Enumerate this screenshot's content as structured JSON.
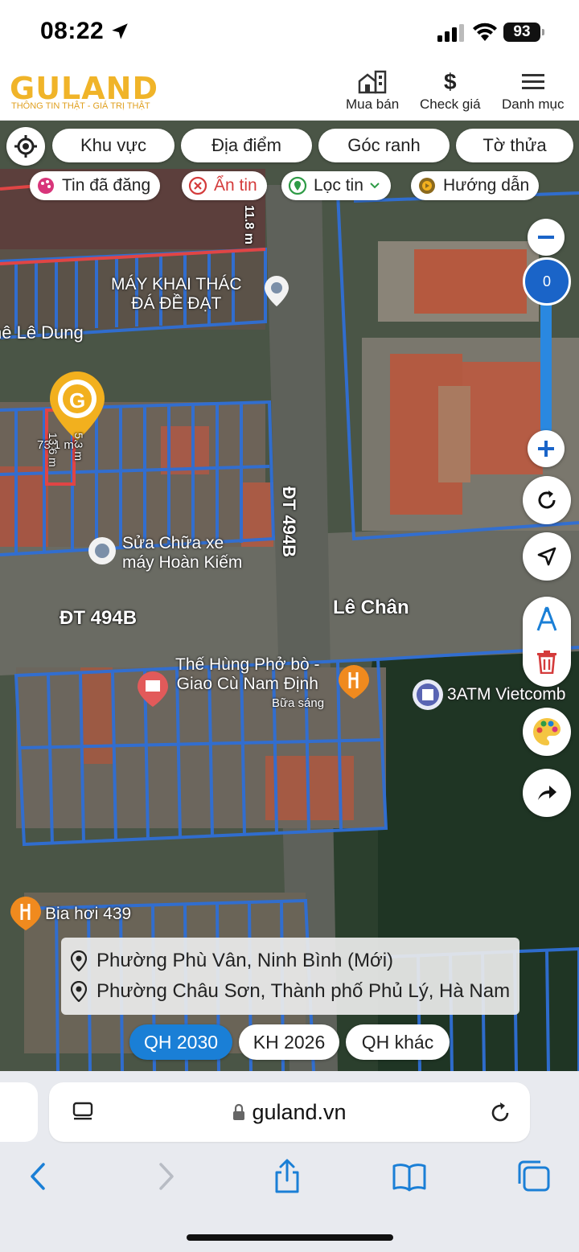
{
  "status_bar": {
    "time": "08:22",
    "battery": "93"
  },
  "header": {
    "logo_text": "GULAND",
    "logo_tagline": "THÔNG TIN THẬT - GIÁ TRỊ THẬT",
    "nav": [
      {
        "label": "Mua bán",
        "icon": "building-icon"
      },
      {
        "label": "Check giá",
        "icon": "dollar-icon"
      },
      {
        "label": "Danh mục",
        "icon": "menu-icon"
      }
    ]
  },
  "filters": {
    "buttons": [
      "Khu vực",
      "Địa điểm",
      "Góc ranh",
      "Tờ thửa"
    ],
    "chips": [
      {
        "label": "Tin đã đăng",
        "icon": "palette-icon"
      },
      {
        "label": "Ẩn tin",
        "icon": "close-circle-icon"
      },
      {
        "label": "Lọc tin",
        "icon": "location-filter-icon"
      },
      {
        "label": "Hướng dẫn",
        "icon": "play-icon"
      }
    ]
  },
  "map": {
    "zoom_value": "0",
    "marker_logo": "G",
    "parcel_area": "73.1 m²",
    "parcel_dim_a": "13.6 m",
    "parcel_dim_b": "5.3 m",
    "edge_dim": "11.8 m",
    "road_labels": {
      "road_1": "ĐT 494B",
      "road_2": "ĐT 494B",
      "area": "Lê Chân",
      "edge_text": "hê Lê Dung"
    },
    "pois": [
      {
        "name": "MÁY KHAI THÁC\nĐÁ ĐỀ ĐẠT"
      },
      {
        "name": "Sửa Chữa xe\nmáy Hoàn Kiếm"
      },
      {
        "name": "Thế Hùng Phở bò -\nGiao Cù Nam Định",
        "sub": "Bữa sáng"
      },
      {
        "name": "3ATM Vietcomb"
      },
      {
        "name": "Bia hơi 439"
      }
    ],
    "colors": {
      "parcel_line": "#2f6fd6",
      "highlight": "#e04545",
      "marker": "#f2b01e"
    }
  },
  "address": {
    "new": "Phường Phù Vân, Ninh Bình (Mới)",
    "old": "Phường Châu Sơn, Thành phố Phủ Lý, Hà Nam"
  },
  "plans": {
    "items": [
      "QH 2030",
      "KH 2026",
      "QH khác"
    ],
    "active": "QH 2030"
  },
  "browser": {
    "url": "guland.vn"
  }
}
